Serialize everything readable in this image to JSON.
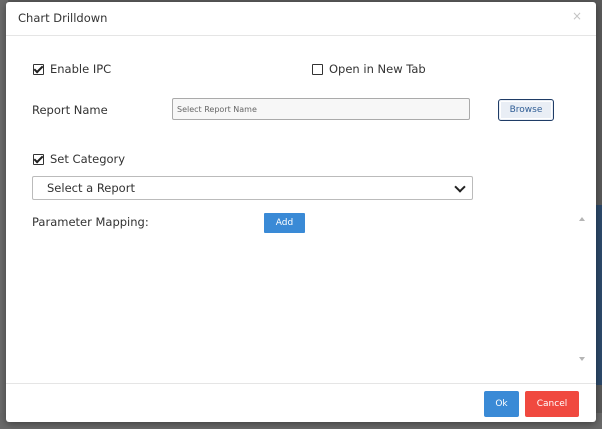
{
  "modal": {
    "title": "Chart Drilldown",
    "close_glyph": "×"
  },
  "options": {
    "enable_ipc": {
      "label": "Enable IPC",
      "checked": true
    },
    "open_new_tab": {
      "label": "Open in New Tab",
      "checked": false
    },
    "set_category": {
      "label": "Set Category",
      "checked": true
    }
  },
  "report_name": {
    "label": "Report Name",
    "placeholder": "Select Report Name",
    "browse_label": "Browse"
  },
  "report_select": {
    "selected": "Select a Report"
  },
  "parameter_mapping": {
    "label": "Parameter Mapping:",
    "add_label": "Add"
  },
  "footer": {
    "ok_label": "Ok",
    "cancel_label": "Cancel"
  },
  "colors": {
    "primary": "#3a8ad6",
    "danger": "#f0493f",
    "browse_border": "#1f3c66"
  }
}
